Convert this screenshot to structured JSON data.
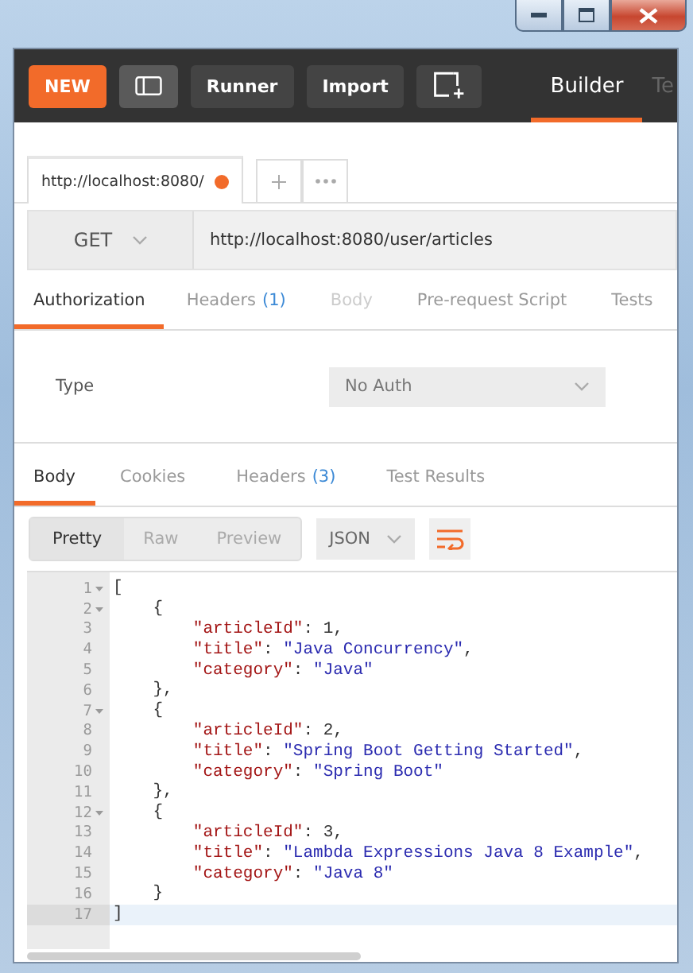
{
  "toolbar": {
    "buttons": [
      {
        "kind": "primary",
        "label": "NEW"
      },
      {
        "kind": "sidebar"
      },
      {
        "kind": "text",
        "label": "Runner"
      },
      {
        "kind": "text",
        "label": "Import"
      },
      {
        "kind": "new-window"
      }
    ],
    "views": [
      {
        "label": "Builder",
        "selected": true
      },
      {
        "label": "Te",
        "selected": false
      }
    ]
  },
  "request_tabs": [
    {
      "label": "http://localhost:8080/",
      "unsaved": true,
      "selected": true
    }
  ],
  "request": {
    "method": "GET",
    "url": "http://localhost:8080/user/articles"
  },
  "request_sections": [
    {
      "label": "Authorization",
      "selected": true,
      "disabled": false
    },
    {
      "label": "Headers",
      "count": "(1)",
      "selected": false,
      "disabled": false
    },
    {
      "label": "Body",
      "selected": false,
      "disabled": true
    },
    {
      "label": "Pre-request Script",
      "selected": false,
      "disabled": false
    },
    {
      "label": "Tests",
      "selected": false,
      "disabled": false
    }
  ],
  "auth": {
    "label": "Type",
    "value": "No Auth"
  },
  "response_sections": [
    {
      "label": "Body",
      "selected": true
    },
    {
      "label": "Cookies",
      "selected": false
    },
    {
      "label": "Headers",
      "count": "(3)",
      "selected": false
    },
    {
      "label": "Test Results",
      "selected": false
    }
  ],
  "view_modes": [
    {
      "label": "Pretty",
      "selected": true
    },
    {
      "label": "Raw",
      "selected": false
    },
    {
      "label": "Preview",
      "selected": false
    }
  ],
  "format": "JSON",
  "code_lines": [
    {
      "number": "1",
      "fold": true,
      "current": false,
      "tokens": [
        {
          "kind": "punct",
          "text": "["
        }
      ]
    },
    {
      "number": "2",
      "fold": true,
      "current": false,
      "tokens": [
        {
          "kind": "punct",
          "text": "    {"
        }
      ]
    },
    {
      "number": "3",
      "fold": false,
      "current": false,
      "tokens": [
        {
          "kind": "key",
          "text": "        \"articleId\""
        },
        {
          "kind": "punct",
          "text": ": "
        },
        {
          "kind": "number",
          "text": "1"
        },
        {
          "kind": "punct",
          "text": ","
        }
      ]
    },
    {
      "number": "4",
      "fold": false,
      "current": false,
      "tokens": [
        {
          "kind": "key",
          "text": "        \"title\""
        },
        {
          "kind": "punct",
          "text": ": "
        },
        {
          "kind": "string",
          "text": "\"Java Concurrency\""
        },
        {
          "kind": "punct",
          "text": ","
        }
      ]
    },
    {
      "number": "5",
      "fold": false,
      "current": false,
      "tokens": [
        {
          "kind": "key",
          "text": "        \"category\""
        },
        {
          "kind": "punct",
          "text": ": "
        },
        {
          "kind": "string",
          "text": "\"Java\""
        }
      ]
    },
    {
      "number": "6",
      "fold": false,
      "current": false,
      "tokens": [
        {
          "kind": "punct",
          "text": "    },"
        }
      ]
    },
    {
      "number": "7",
      "fold": true,
      "current": false,
      "tokens": [
        {
          "kind": "punct",
          "text": "    {"
        }
      ]
    },
    {
      "number": "8",
      "fold": false,
      "current": false,
      "tokens": [
        {
          "kind": "key",
          "text": "        \"articleId\""
        },
        {
          "kind": "punct",
          "text": ": "
        },
        {
          "kind": "number",
          "text": "2"
        },
        {
          "kind": "punct",
          "text": ","
        }
      ]
    },
    {
      "number": "9",
      "fold": false,
      "current": false,
      "tokens": [
        {
          "kind": "key",
          "text": "        \"title\""
        },
        {
          "kind": "punct",
          "text": ": "
        },
        {
          "kind": "string",
          "text": "\"Spring Boot Getting Started\""
        },
        {
          "kind": "punct",
          "text": ","
        }
      ]
    },
    {
      "number": "10",
      "fold": false,
      "current": false,
      "tokens": [
        {
          "kind": "key",
          "text": "        \"category\""
        },
        {
          "kind": "punct",
          "text": ": "
        },
        {
          "kind": "string",
          "text": "\"Spring Boot\""
        }
      ]
    },
    {
      "number": "11",
      "fold": false,
      "current": false,
      "tokens": [
        {
          "kind": "punct",
          "text": "    },"
        }
      ]
    },
    {
      "number": "12",
      "fold": true,
      "current": false,
      "tokens": [
        {
          "kind": "punct",
          "text": "    {"
        }
      ]
    },
    {
      "number": "13",
      "fold": false,
      "current": false,
      "tokens": [
        {
          "kind": "key",
          "text": "        \"articleId\""
        },
        {
          "kind": "punct",
          "text": ": "
        },
        {
          "kind": "number",
          "text": "3"
        },
        {
          "kind": "punct",
          "text": ","
        }
      ]
    },
    {
      "number": "14",
      "fold": false,
      "current": false,
      "tokens": [
        {
          "kind": "key",
          "text": "        \"title\""
        },
        {
          "kind": "punct",
          "text": ": "
        },
        {
          "kind": "string",
          "text": "\"Lambda Expressions Java 8 Example\""
        },
        {
          "kind": "punct",
          "text": ","
        }
      ]
    },
    {
      "number": "15",
      "fold": false,
      "current": false,
      "tokens": [
        {
          "kind": "key",
          "text": "        \"category\""
        },
        {
          "kind": "punct",
          "text": ": "
        },
        {
          "kind": "string",
          "text": "\"Java 8\""
        }
      ]
    },
    {
      "number": "16",
      "fold": false,
      "current": false,
      "tokens": [
        {
          "kind": "punct",
          "text": "    }"
        }
      ]
    },
    {
      "number": "17",
      "fold": false,
      "current": true,
      "tokens": [
        {
          "kind": "punct",
          "text": "]"
        }
      ]
    }
  ]
}
